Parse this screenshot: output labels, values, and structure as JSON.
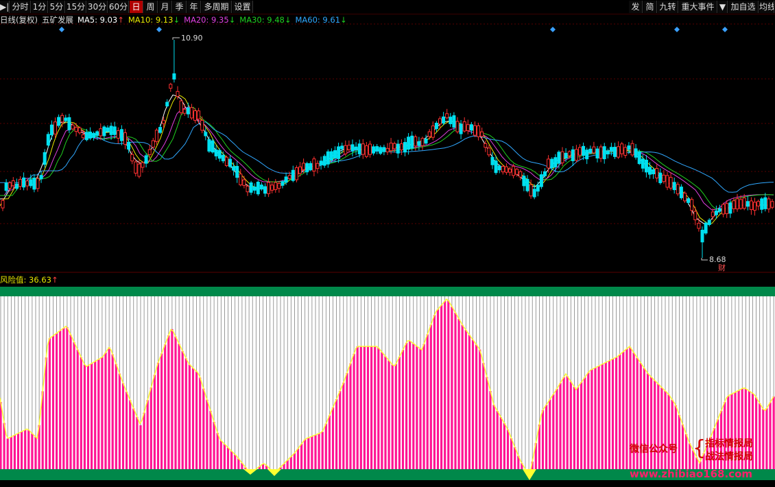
{
  "toolbar": {
    "left": [
      {
        "label": "▶|",
        "name": "step-icon"
      },
      {
        "label": "分时",
        "name": "tab-fenshi"
      },
      {
        "label": "1分",
        "name": "tab-1min"
      },
      {
        "label": "5分",
        "name": "tab-5min"
      },
      {
        "label": "15分",
        "name": "tab-15min"
      },
      {
        "label": "30分",
        "name": "tab-30min"
      },
      {
        "label": "60分",
        "name": "tab-60min"
      },
      {
        "label": "日",
        "name": "tab-day"
      },
      {
        "label": "周",
        "name": "tab-week"
      },
      {
        "label": "月",
        "name": "tab-month"
      },
      {
        "label": "季",
        "name": "tab-quarter"
      },
      {
        "label": "年",
        "name": "tab-year"
      },
      {
        "label": "多周期",
        "name": "tab-multi-period"
      },
      {
        "label": "设置",
        "name": "settings-button"
      }
    ],
    "active": "日",
    "right": [
      {
        "label": "发",
        "name": "btn-fa"
      },
      {
        "label": "简",
        "name": "btn-jian"
      },
      {
        "label": "九转",
        "name": "btn-jiuzhuan"
      },
      {
        "label": "重大事件",
        "name": "btn-major-events"
      },
      {
        "label": "▼",
        "name": "dropdown-arrow-icon"
      },
      {
        "label": "加自选",
        "name": "btn-add-watchlist"
      },
      {
        "label": "均线",
        "name": "btn-moving-average"
      }
    ]
  },
  "info": {
    "period": "日线(复权)",
    "stock": "五矿发展",
    "ma": [
      {
        "label": "MA5: 9.03",
        "arrow": "↑",
        "color": "#ffffff"
      },
      {
        "label": "MA10: 9.13",
        "arrow": "↓",
        "color": "#e8e800"
      },
      {
        "label": "MA20: 9.35",
        "arrow": "↓",
        "color": "#e040e0"
      },
      {
        "label": "MA30: 9.48",
        "arrow": "↓",
        "color": "#20d020"
      },
      {
        "label": "MA60: 9.61",
        "arrow": "↓",
        "color": "#30a8ff"
      }
    ]
  },
  "price_labels": {
    "high": "10.90",
    "low": "8.68",
    "event": "财"
  },
  "risk": {
    "label": "风险值: 36.63",
    "arrow": "↑"
  },
  "watermark": {
    "left": "微信公众号",
    "right_top": "指标情报局",
    "right_bottom": "战法情报局",
    "url": "www.zhibiao168.com"
  },
  "colors": {
    "up": "#ff3030",
    "down": "#00e0f0",
    "risk_bar": "#ff1493",
    "band": "#00884a",
    "active_tab": "#b00000"
  }
}
